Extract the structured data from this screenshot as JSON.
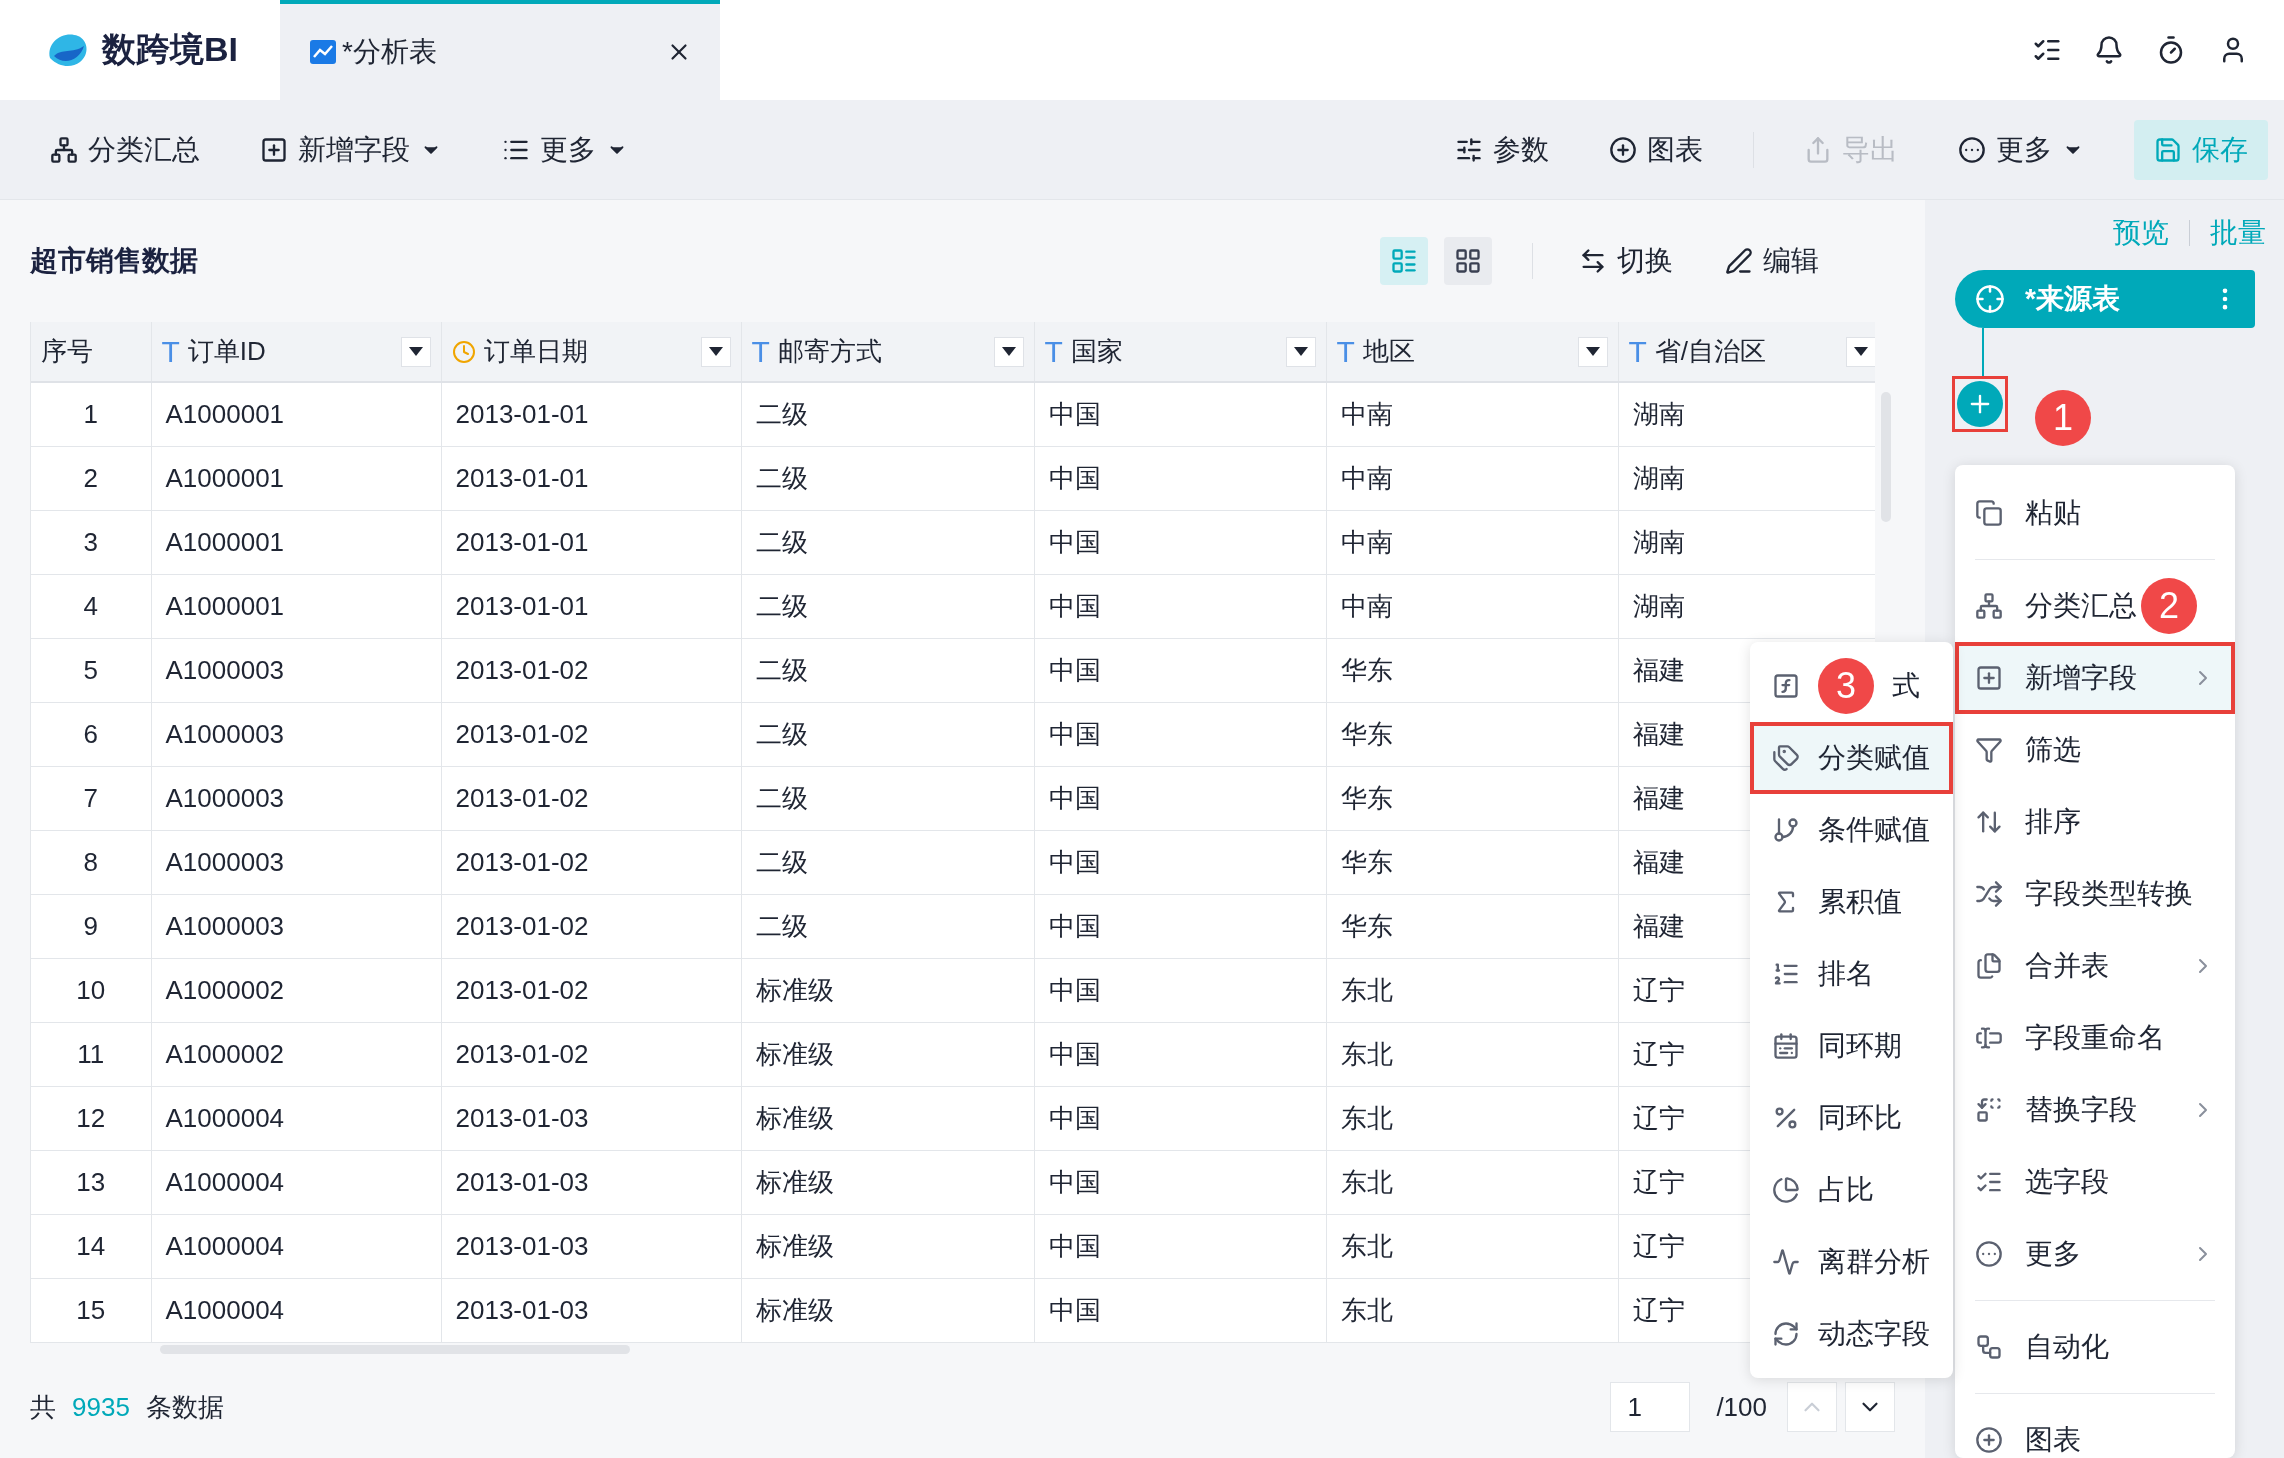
{
  "app": {
    "logo": "数跨境BI"
  },
  "tabs": [
    {
      "label": "*分析表",
      "selected": true
    }
  ],
  "toolbar": {
    "left": [
      {
        "label": "分类汇总",
        "dropdown": false
      },
      {
        "label": "新增字段",
        "dropdown": true
      },
      {
        "label": "更多",
        "dropdown": true
      }
    ],
    "right": [
      {
        "label": "参数",
        "disabled": false,
        "dropdown": false
      },
      {
        "label": "图表",
        "disabled": false,
        "dropdown": false
      },
      {
        "label": "导出",
        "disabled": true,
        "dropdown": false
      },
      {
        "label": "更多",
        "disabled": false,
        "dropdown": true
      }
    ],
    "save": "保存"
  },
  "table": {
    "title": "超市销售数据",
    "view_toggle": [
      {
        "selected": true
      },
      {
        "selected": false
      }
    ],
    "actions": [
      "切换",
      "编辑"
    ],
    "columns": [
      {
        "label": "序号",
        "kind": "index",
        "filter": false
      },
      {
        "label": "订单ID",
        "kind": "text",
        "glyph": "T",
        "filter": true
      },
      {
        "label": "订单日期",
        "kind": "date",
        "filter": true
      },
      {
        "label": "邮寄方式",
        "kind": "text",
        "glyph": "T",
        "filter": true
      },
      {
        "label": "国家",
        "kind": "text",
        "glyph": "T",
        "filter": true
      },
      {
        "label": "地区",
        "kind": "text",
        "glyph": "T",
        "filter": true
      },
      {
        "label": "省/自治区",
        "kind": "text",
        "glyph": "T",
        "filter": true
      }
    ],
    "rows": [
      [
        "1",
        "A1000001",
        "2013-01-01",
        "二级",
        "中国",
        "中南",
        "湖南"
      ],
      [
        "2",
        "A1000001",
        "2013-01-01",
        "二级",
        "中国",
        "中南",
        "湖南"
      ],
      [
        "3",
        "A1000001",
        "2013-01-01",
        "二级",
        "中国",
        "中南",
        "湖南"
      ],
      [
        "4",
        "A1000001",
        "2013-01-01",
        "二级",
        "中国",
        "中南",
        "湖南"
      ],
      [
        "5",
        "A1000003",
        "2013-01-02",
        "二级",
        "中国",
        "华东",
        "福建"
      ],
      [
        "6",
        "A1000003",
        "2013-01-02",
        "二级",
        "中国",
        "华东",
        "福建"
      ],
      [
        "7",
        "A1000003",
        "2013-01-02",
        "二级",
        "中国",
        "华东",
        "福建"
      ],
      [
        "8",
        "A1000003",
        "2013-01-02",
        "二级",
        "中国",
        "华东",
        "福建"
      ],
      [
        "9",
        "A1000003",
        "2013-01-02",
        "二级",
        "中国",
        "华东",
        "福建"
      ],
      [
        "10",
        "A1000002",
        "2013-01-02",
        "标准级",
        "中国",
        "东北",
        "辽宁"
      ],
      [
        "11",
        "A1000002",
        "2013-01-02",
        "标准级",
        "中国",
        "东北",
        "辽宁"
      ],
      [
        "12",
        "A1000004",
        "2013-01-03",
        "标准级",
        "中国",
        "东北",
        "辽宁"
      ],
      [
        "13",
        "A1000004",
        "2013-01-03",
        "标准级",
        "中国",
        "东北",
        "辽宁"
      ],
      [
        "14",
        "A1000004",
        "2013-01-03",
        "标准级",
        "中国",
        "东北",
        "辽宁"
      ],
      [
        "15",
        "A1000004",
        "2013-01-03",
        "标准级",
        "中国",
        "东北",
        "辽宁"
      ]
    ]
  },
  "footer": {
    "prefix": "共",
    "total": "9935",
    "suffix": "条数据",
    "page": "1",
    "page_total": "/100"
  },
  "side": {
    "links": [
      "预览",
      "批量"
    ],
    "node": "*来源表",
    "badges": [
      "1",
      "2",
      "3"
    ],
    "menu_groups": [
      [
        {
          "label": "粘贴",
          "submenu": false,
          "selected": false
        }
      ],
      [
        {
          "label": "分类汇总",
          "submenu": false,
          "selected": false
        },
        {
          "label": "新增字段",
          "submenu": true,
          "selected": true
        },
        {
          "label": "筛选",
          "submenu": false,
          "selected": false
        },
        {
          "label": "排序",
          "submenu": false,
          "selected": false
        },
        {
          "label": "字段类型转换",
          "submenu": false,
          "selected": false
        },
        {
          "label": "合并表",
          "submenu": true,
          "selected": false
        },
        {
          "label": "字段重命名",
          "submenu": false,
          "selected": false
        },
        {
          "label": "替换字段",
          "submenu": true,
          "selected": false
        },
        {
          "label": "选字段",
          "submenu": false,
          "selected": false
        },
        {
          "label": "更多",
          "submenu": true,
          "selected": false
        }
      ],
      [
        {
          "label": "自动化",
          "submenu": false,
          "selected": false
        }
      ],
      [
        {
          "label": "图表",
          "submenu": false,
          "selected": false
        }
      ]
    ],
    "submenu": [
      {
        "label": "式",
        "selected": false
      },
      {
        "label": "分类赋值",
        "selected": true
      },
      {
        "label": "条件赋值",
        "selected": false
      },
      {
        "label": "累积值",
        "selected": false
      },
      {
        "label": "排名",
        "selected": false
      },
      {
        "label": "同环期",
        "selected": false
      },
      {
        "label": "同环比",
        "selected": false
      },
      {
        "label": "占比",
        "selected": false
      },
      {
        "label": "离群分析",
        "selected": false
      },
      {
        "label": "动态字段",
        "selected": false
      }
    ]
  }
}
